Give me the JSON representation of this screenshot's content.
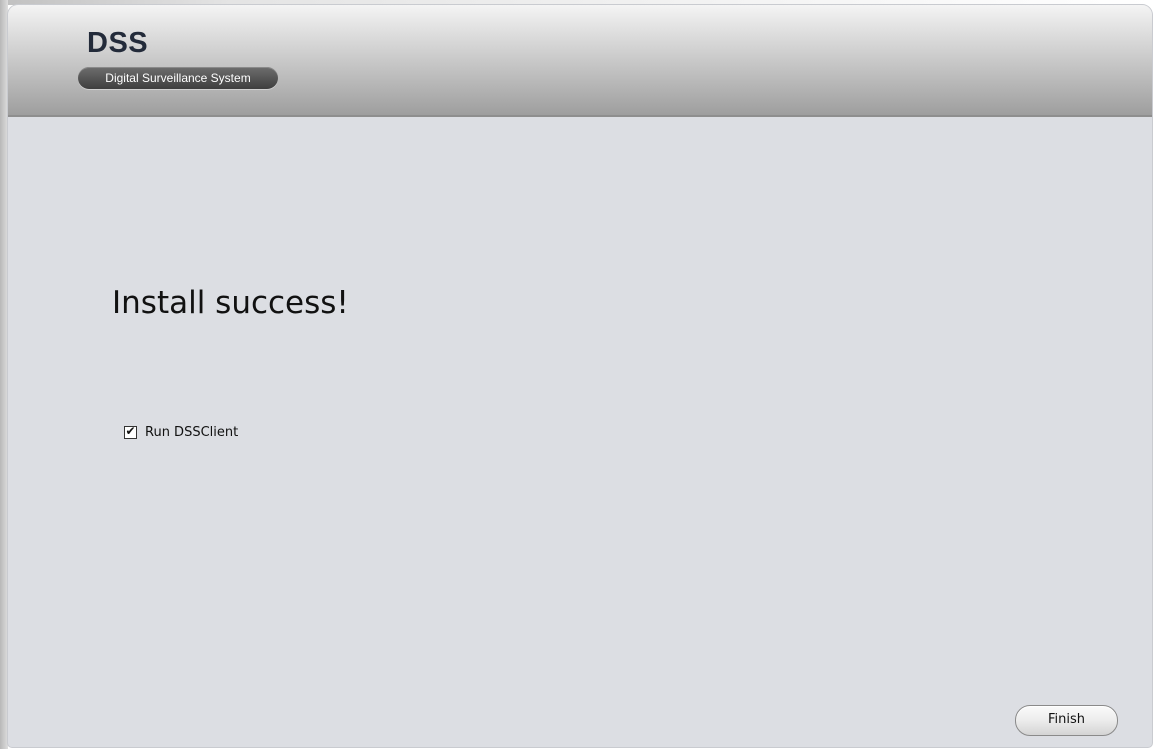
{
  "header": {
    "logo_title": "DSS",
    "logo_subtitle": "Digital Surveillance System"
  },
  "main": {
    "headline": "Install success!",
    "run_option": {
      "label": "Run DSSClient",
      "checked": true,
      "check_glyph": "✔"
    }
  },
  "footer": {
    "finish_label": "Finish"
  }
}
